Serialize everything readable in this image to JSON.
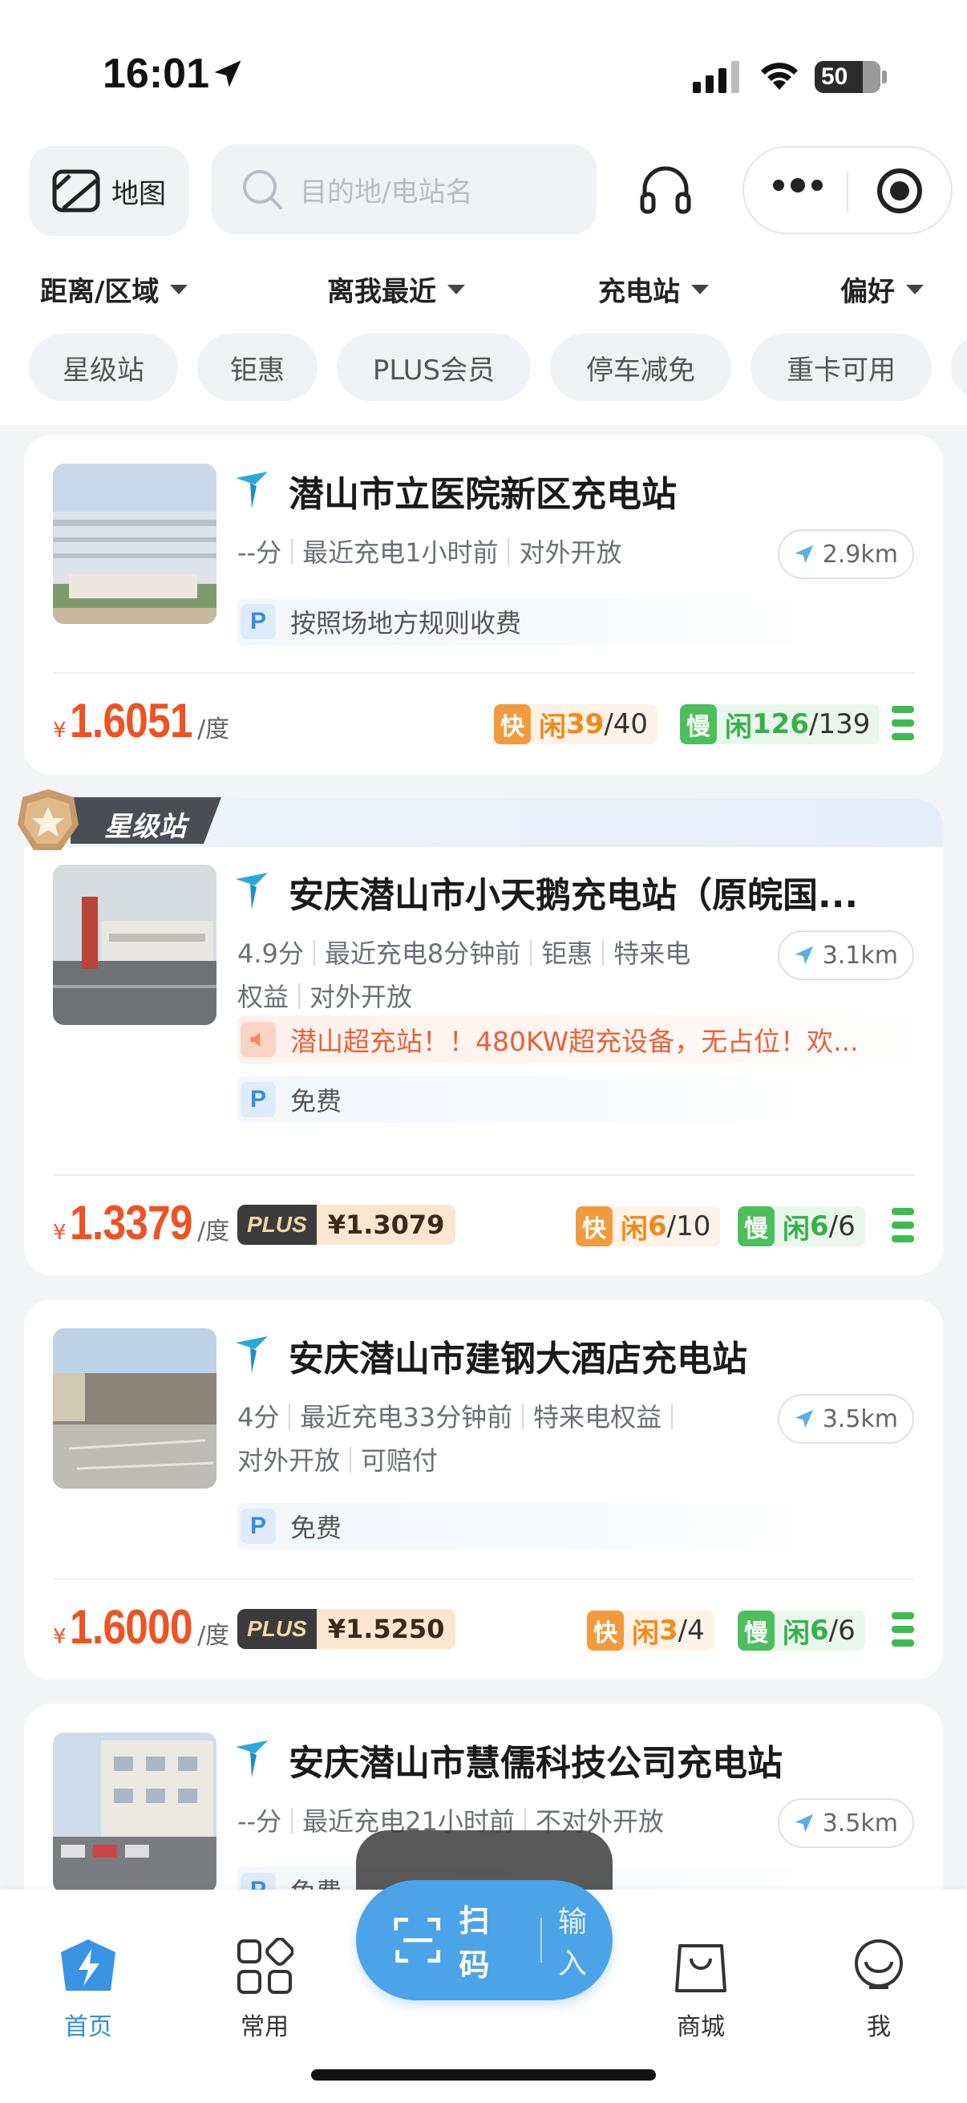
{
  "status_bar": {
    "time": "16:01",
    "battery": "50"
  },
  "header": {
    "map_label": "地图",
    "search_placeholder": "目的地/电站名"
  },
  "filters": [
    "距离/区域",
    "离我最近",
    "充电站",
    "偏好"
  ],
  "chips": [
    "星级站",
    "钜惠",
    "PLUS会员",
    "停车减免",
    "重卡可用"
  ],
  "stations": [
    {
      "name": "潜山市立医院新区充电站",
      "meta_line1": [
        "--分",
        "最近充电1小时前",
        "对外开放"
      ],
      "meta_line2": [],
      "distance": "2.9km",
      "parking": "按照场地方规则收费",
      "price": "1.6051",
      "unit": "/度",
      "fast": {
        "label": "快",
        "free_prefix": "闲",
        "free": "39",
        "total": "/40"
      },
      "slow": {
        "label": "慢",
        "free_prefix": "闲",
        "free": "126",
        "total": "/139"
      }
    },
    {
      "badge": "星级站",
      "name": "安庆潜山市小天鹅充电站（原皖国...",
      "meta_line1": [
        "4.9分",
        "最近充电8分钟前",
        "钜惠",
        "特来电"
      ],
      "meta_line2": [
        "权益",
        "对外开放"
      ],
      "distance": "3.1km",
      "notice": "潜山超充站！！480KW超充设备，无占位！欢...",
      "parking": "免费",
      "price": "1.3379",
      "unit": "/度",
      "plus_tag": "PLUS",
      "plus_price": "¥1.3079",
      "fast": {
        "label": "快",
        "free_prefix": "闲",
        "free": "6",
        "total": "/10"
      },
      "slow": {
        "label": "慢",
        "free_prefix": "闲",
        "free": "6",
        "total": "/6"
      }
    },
    {
      "name": "安庆潜山市建钢大酒店充电站",
      "meta_line1": [
        "4分",
        "最近充电33分钟前",
        "特来电权益"
      ],
      "meta_line2": [
        "对外开放",
        "可赔付"
      ],
      "distance": "3.5km",
      "parking": "免费",
      "price": "1.6000",
      "unit": "/度",
      "plus_tag": "PLUS",
      "plus_price": "¥1.5250",
      "fast": {
        "label": "快",
        "free_prefix": "闲",
        "free": "3",
        "total": "/4"
      },
      "slow": {
        "label": "慢",
        "free_prefix": "闲",
        "free": "6",
        "total": "/6"
      }
    },
    {
      "name": "安庆潜山市慧儒科技公司充电站",
      "meta_line1": [
        "--分",
        "最近充电21小时前",
        "不对外开放"
      ],
      "distance": "3.5km",
      "parking": "免费"
    }
  ],
  "currency_symbol": "¥",
  "tabbar": {
    "home": "首页",
    "common": "常用",
    "scan": "扫码",
    "input": "输入",
    "mall": "商城",
    "me": "我"
  },
  "colors": {
    "accent": "#4ba3e8",
    "price": "#ef5223",
    "fast": "#f29b3e",
    "slow": "#4cbf5c"
  }
}
